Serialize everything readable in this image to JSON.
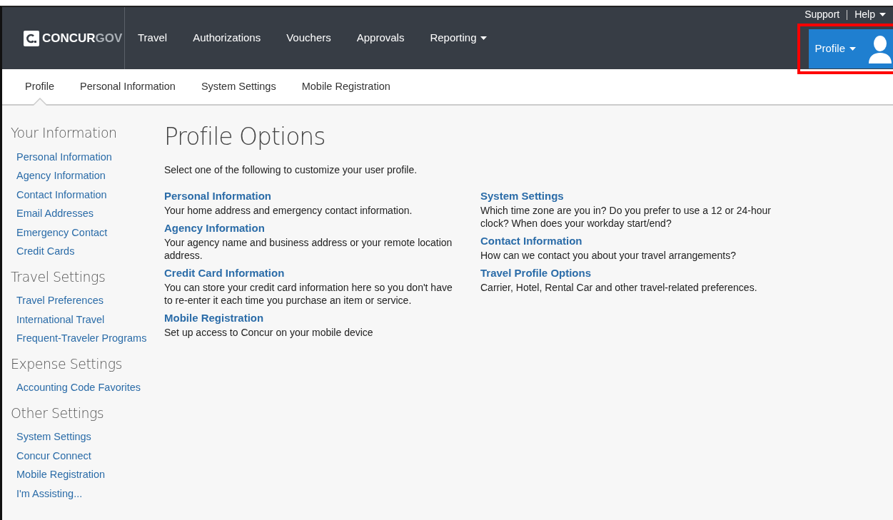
{
  "header": {
    "logo": {
      "brand": "CONCUR",
      "suffix": "GOV"
    },
    "nav": [
      {
        "label": "Travel",
        "dropdown": false
      },
      {
        "label": "Authorizations",
        "dropdown": false
      },
      {
        "label": "Vouchers",
        "dropdown": false
      },
      {
        "label": "Approvals",
        "dropdown": false
      },
      {
        "label": "Reporting",
        "dropdown": true
      }
    ],
    "utility_links": [
      {
        "label": "Support",
        "dropdown": false
      },
      {
        "label": "Help",
        "dropdown": true
      }
    ],
    "profile_button": {
      "label": "Profile",
      "highlighted": true
    }
  },
  "tabs": [
    {
      "label": "Profile",
      "selected": true
    },
    {
      "label": "Personal Information",
      "selected": false
    },
    {
      "label": "System Settings",
      "selected": false
    },
    {
      "label": "Mobile Registration",
      "selected": false
    }
  ],
  "sidebar": [
    {
      "heading": "Your Information",
      "items": [
        "Personal Information",
        "Agency Information",
        "Contact Information",
        "Email Addresses",
        "Emergency Contact",
        "Credit Cards"
      ]
    },
    {
      "heading": "Travel Settings",
      "items": [
        "Travel Preferences",
        "International Travel",
        "Frequent-Traveler Programs"
      ]
    },
    {
      "heading": "Expense Settings",
      "items": [
        "Accounting Code Favorites"
      ]
    },
    {
      "heading": "Other Settings",
      "items": [
        "System Settings",
        "Concur Connect",
        "Mobile Registration",
        "I'm Assisting..."
      ]
    }
  ],
  "main": {
    "title": "Profile Options",
    "intro": "Select one of the following to customize your user profile.",
    "columns": [
      [
        {
          "title": "Personal Information",
          "description": "Your home address and emergency contact information."
        },
        {
          "title": "Agency Information",
          "description": "Your agency name and business address or your remote location address."
        },
        {
          "title": "Credit Card Information",
          "description": "You can store your credit card information here so you don't have to re-enter it each time you purchase an item or service."
        },
        {
          "title": "Mobile Registration",
          "description": "Set up access to Concur on your mobile device"
        }
      ],
      [
        {
          "title": "System Settings",
          "description": "Which time zone are you in? Do you prefer to use a 12 or 24-hour clock? When does your workday start/end?"
        },
        {
          "title": "Contact Information",
          "description": "How can we contact you about your travel arrangements?"
        },
        {
          "title": "Travel Profile Options",
          "description": "Carrier, Hotel, Rental Car and other travel-related preferences."
        }
      ]
    ]
  }
}
